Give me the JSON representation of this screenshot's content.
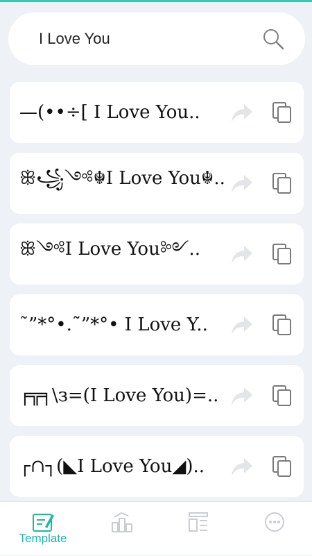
{
  "search": {
    "value": "I Love You"
  },
  "styles": [
    "—(••÷[ I Love You..",
    "ꕥ꧁༺☬I Love You☬..",
    "ꕥ༺I Love You༻..",
    "˜”*°•.˜”*°• I Love Y..",
    "╒╦╕\\з=(I Love You)=..",
    "┌∩┐(◣I Love You◢).."
  ],
  "nav": {
    "template_label": "Template"
  },
  "colors": {
    "accent": "#1fb8a6",
    "icon_gray": "#c9ccd1",
    "background": "#eef1f5"
  },
  "icons": [
    "search-icon",
    "share-icon",
    "copy-icon",
    "template-icon",
    "chart-icon",
    "layout-icon",
    "more-icon"
  ]
}
